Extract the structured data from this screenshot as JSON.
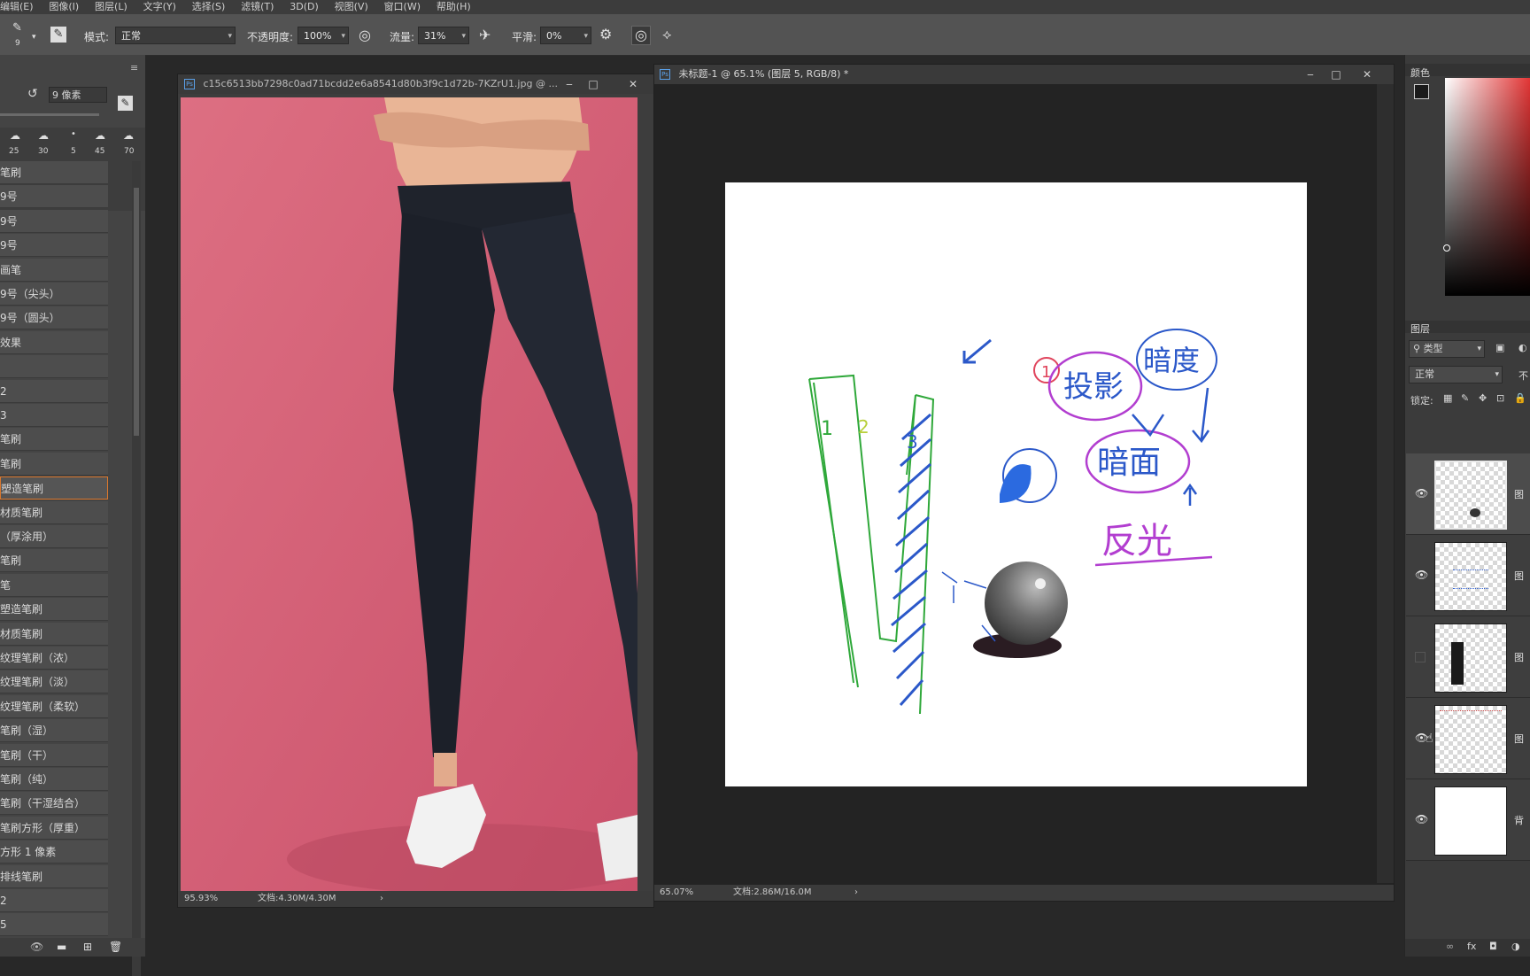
{
  "menu": [
    "编辑(E)",
    "图像(I)",
    "图层(L)",
    "文字(Y)",
    "选择(S)",
    "滤镜(T)",
    "3D(D)",
    "视图(V)",
    "窗口(W)",
    "帮助(H)"
  ],
  "options_bar": {
    "brush_size": "9",
    "mode_label": "模式:",
    "mode_value": "正常",
    "opacity_label": "不透明度:",
    "opacity_value": "100%",
    "flow_label": "流量:",
    "flow_value": "31%",
    "smoothing_label": "平滑:",
    "smoothing_value": "0%"
  },
  "brush_panel": {
    "size_value": "9 像素",
    "preset_sizes": [
      "25",
      "30",
      "5",
      "45",
      "70"
    ],
    "items": [
      "笔刷",
      "9号",
      "9号",
      "9号",
      "画笔",
      "9号（尖头）",
      "9号（圆头）",
      "效果",
      "",
      "2",
      "3",
      "笔刷",
      "笔刷",
      "塑造笔刷",
      "材质笔刷",
      "（厚涂用）",
      "笔刷",
      "笔",
      "塑造笔刷",
      "材质笔刷",
      "纹理笔刷（浓）",
      "纹理笔刷（淡）",
      "纹理笔刷（柔软）",
      "笔刷（湿）",
      "笔刷（干）",
      "笔刷（纯）",
      "笔刷（干湿结合）",
      "笔刷方形（厚重）",
      "方形 1 像素",
      "排线笔刷",
      "2",
      "5"
    ],
    "selected_index": 13
  },
  "doc1": {
    "title": "c15c6513bb7298c0ad71bcdd2e6a8541d80b3f9c1d72b-7KZrU1.jpg @ ...",
    "zoom": "95.93%",
    "doc_size": "文档:4.30M/4.30M"
  },
  "doc2": {
    "title": "未标题-1 @ 65.1% (图层 5, RGB/8) *",
    "zoom": "65.07%",
    "doc_size": "文档:2.86M/16.0M"
  },
  "sketch_text": {
    "num1": "1",
    "num2": "2",
    "num3": "3",
    "circled": "1",
    "cast_shadow": "投影",
    "shadow_line": "暗度",
    "dark_side": "暗面",
    "reflected": "反光"
  },
  "color_panel": {
    "tab": "颜色"
  },
  "layers_panel": {
    "tab": "图层",
    "filter": "类型",
    "blend": "正常",
    "opacity_short": "不",
    "lock_label": "锁定:",
    "layers": [
      {
        "name": "图",
        "visible": true,
        "thumb": "small-sphere"
      },
      {
        "name": "图",
        "visible": true,
        "thumb": "blue-strokes"
      },
      {
        "name": "图",
        "visible": false,
        "thumb": "leggings"
      },
      {
        "name": "图",
        "visible": true,
        "thumb": "red-strokes"
      },
      {
        "name": "背",
        "visible": true,
        "thumb": "white"
      }
    ]
  },
  "colors": {
    "accent_selected": "#d9772d",
    "pink_bg": "#d9677a",
    "legging": "#1c2029"
  }
}
